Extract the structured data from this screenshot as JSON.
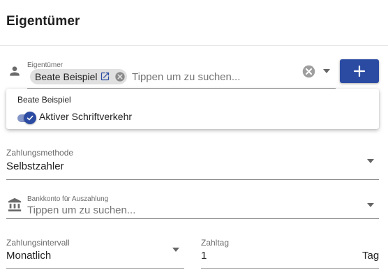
{
  "section": {
    "title": "Eigentümer"
  },
  "owner_field": {
    "label": "Eigentümer",
    "chip_label": "Beate Beispiel",
    "placeholder": "Tippen um zu suchen..."
  },
  "owner_dropdown": {
    "header": "Beate Beispiel",
    "item_label": "Aktiver Schriftverkehr",
    "item_checked": true
  },
  "payment_method": {
    "label": "Zahlungsmethode",
    "value": "Selbstzahler"
  },
  "bank_account": {
    "label": "Bankkonto für Auszahlung",
    "placeholder": "Tippen um zu suchen..."
  },
  "payment_interval": {
    "label": "Zahlungsintervall",
    "value": "Monatlich"
  },
  "payment_day": {
    "label": "Zahltag",
    "value": "1",
    "suffix": "Tag"
  },
  "colors": {
    "primary": "#2b4ba3",
    "chip_background": "#e0e0e0"
  }
}
